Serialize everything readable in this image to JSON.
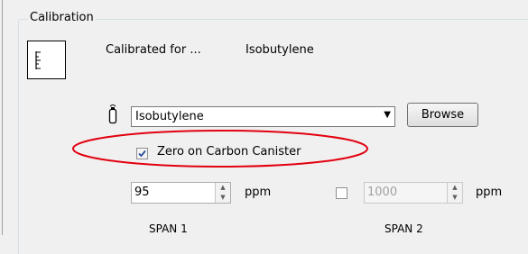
{
  "group": {
    "title": "Calibration"
  },
  "calibrated": {
    "label": "Calibrated for ...",
    "gas": "Isobutylene",
    "icon": "calibration-ruler-icon"
  },
  "gas_select": {
    "icon": "gas-cylinder-icon",
    "selected": "Isobutylene",
    "browse_label": "Browse"
  },
  "zero": {
    "label": "Zero on Carbon Canister",
    "checked": true,
    "highlight_color": "#e3000f"
  },
  "span1": {
    "value": "95",
    "unit": "ppm",
    "label": "SPAN 1"
  },
  "span2": {
    "enabled": false,
    "value": "1000",
    "unit": "ppm",
    "label": "SPAN 2"
  }
}
